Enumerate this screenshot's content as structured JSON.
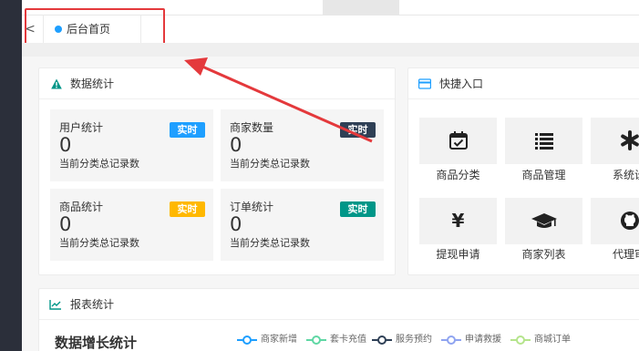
{
  "tabbar": {
    "active_tab": "后台首页"
  },
  "stats_card": {
    "title": "数据统计",
    "items": [
      {
        "label": "用户统计",
        "value": "0",
        "desc": "当前分类总记录数",
        "badge": "实时",
        "badge_color": "#1e9fff"
      },
      {
        "label": "商家数量",
        "value": "0",
        "desc": "当前分类总记录数",
        "badge": "实时",
        "badge_color": "#2f4056"
      },
      {
        "label": "商品统计",
        "value": "0",
        "desc": "当前分类总记录数",
        "badge": "实时",
        "badge_color": "#ffb800"
      },
      {
        "label": "订单统计",
        "value": "0",
        "desc": "当前分类总记录数",
        "badge": "实时",
        "badge_color": "#009688"
      }
    ]
  },
  "quick_card": {
    "title": "快捷入口",
    "items": [
      {
        "label": "商品分类",
        "icon": "calendar-check-icon"
      },
      {
        "label": "商品管理",
        "icon": "list-icon"
      },
      {
        "label": "系统设",
        "icon": "asterisk-icon"
      },
      {
        "label": "提现申请",
        "icon": "yen-icon"
      },
      {
        "label": "商家列表",
        "icon": "graduation-cap-icon"
      },
      {
        "label": "代理审",
        "icon": "github-icon"
      }
    ]
  },
  "report_card": {
    "title": "报表统计",
    "chart_title": "数据增长统计",
    "legend": [
      {
        "name": "商家新增",
        "color": "#1e9fff"
      },
      {
        "name": "套卡充值",
        "color": "#5fd7a4"
      },
      {
        "name": "服务预约",
        "color": "#2f4056"
      },
      {
        "name": "申请救援",
        "color": "#8fa4f0"
      },
      {
        "name": "商城订单",
        "color": "#b5e48c"
      }
    ]
  },
  "colors": {
    "annotation": "#e4393c",
    "accent": "#1e9fff"
  }
}
